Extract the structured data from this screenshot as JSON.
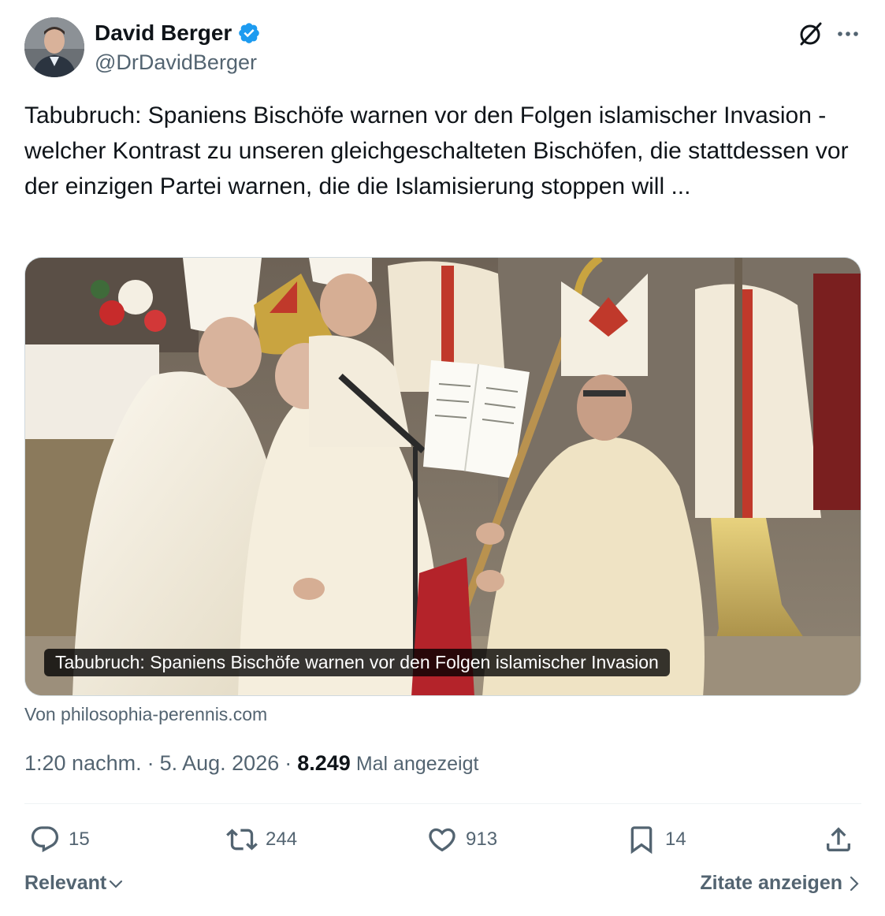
{
  "author": {
    "display_name": "David Berger",
    "handle": "@DrDavidBerger",
    "verified": true,
    "avatar_icon": "avatar-photo"
  },
  "tweet": {
    "text": "Tabubruch: Spaniens Bischöfe warnen vor den Folgen islamischer Invasion - welcher Kontrast zu unseren gleichgeschalteten Bischöfen, die stattdessen vor der einzigen Partei warnen, die die Islamisierung stoppen will ..."
  },
  "card": {
    "caption": "Tabubruch: Spaniens Bischöfe warnen vor den Folgen islamischer Invasion",
    "source": "Von philosophia-perennis.com"
  },
  "meta": {
    "time": "1:20 nachm.",
    "separator": "·",
    "date": "5. Aug. 2026",
    "views_count": "8.249",
    "views_label": "Mal angezeigt"
  },
  "actions": {
    "replies": "15",
    "reposts": "244",
    "likes": "913",
    "bookmarks": "14"
  },
  "footer": {
    "sort_label": "Relevant",
    "quotes_label": "Zitate anzeigen"
  },
  "colors": {
    "text": "#0f1419",
    "secondary": "#536471",
    "verified": "#1d9bf0",
    "border": "#cfd9de"
  }
}
